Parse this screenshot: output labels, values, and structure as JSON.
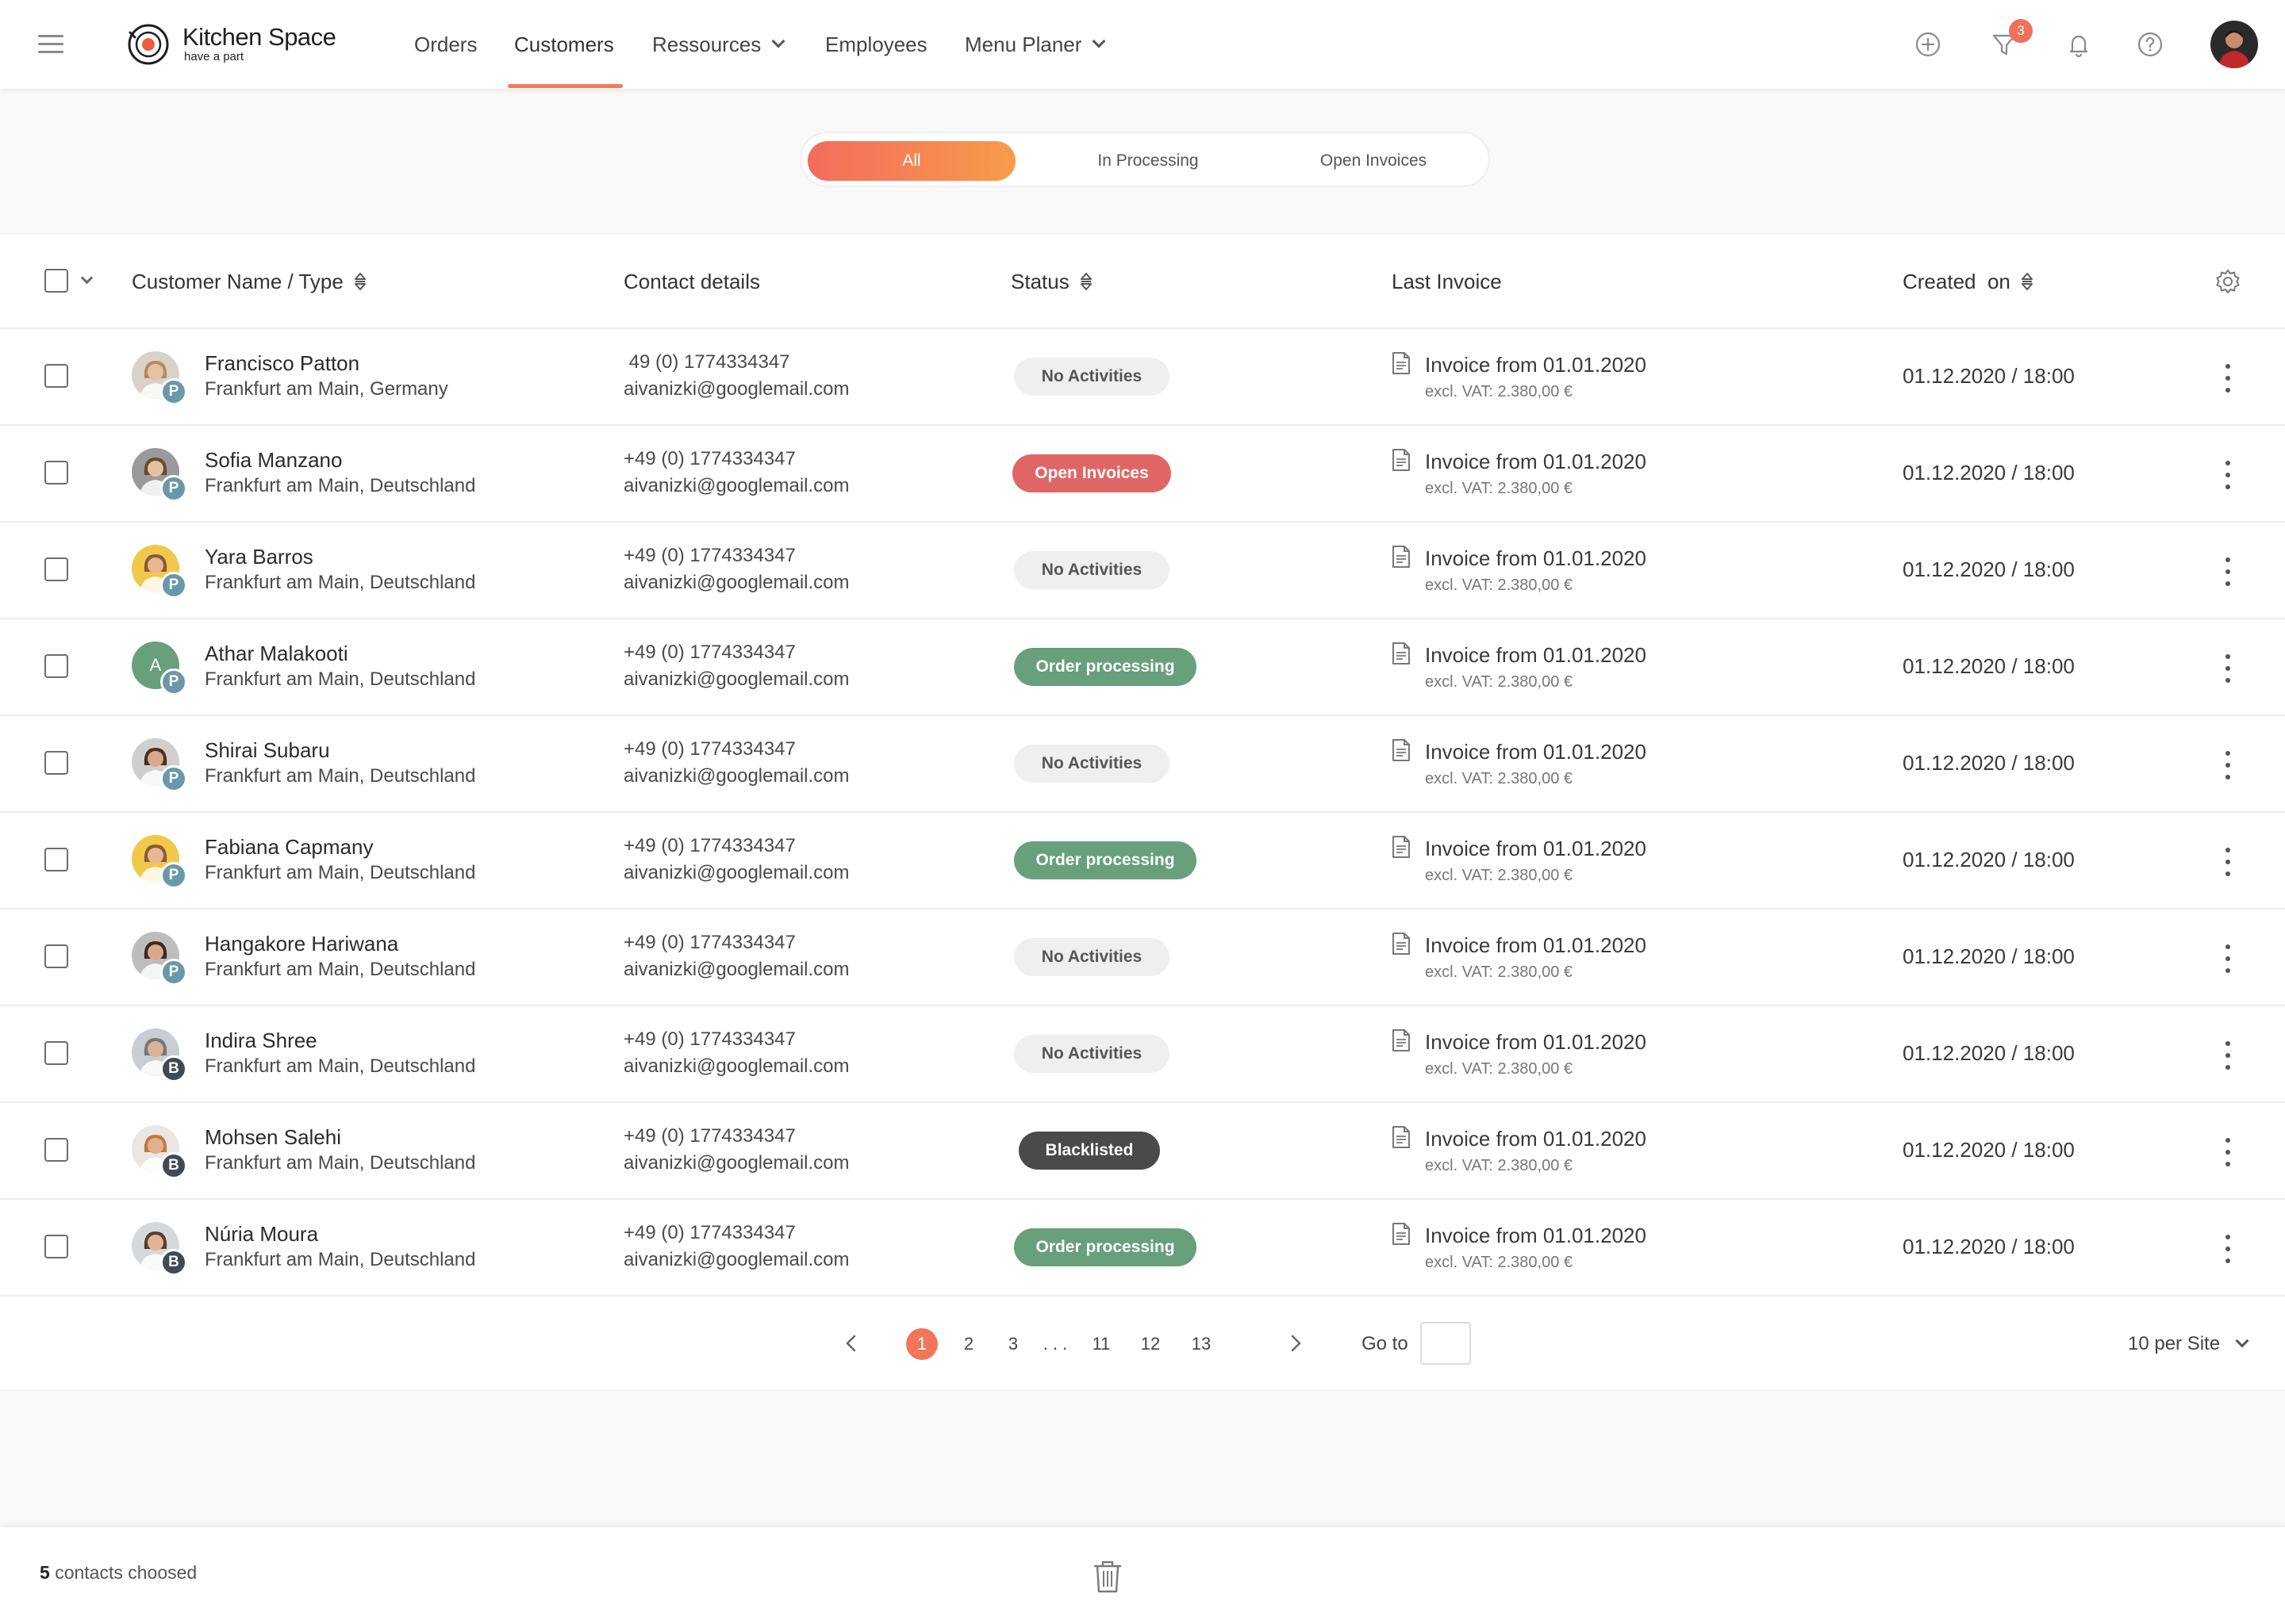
{
  "brand": {
    "name": "Kitchen Space",
    "tagline": "have a part",
    "accent_color": "#f47a55"
  },
  "nav": {
    "items": [
      {
        "label": "Orders",
        "active": false
      },
      {
        "label": "Customers",
        "active": true
      },
      {
        "label": "Ressources",
        "active": false,
        "dropdown": true
      },
      {
        "label": "Employees",
        "active": false
      },
      {
        "label": "Menu Planer",
        "active": false,
        "dropdown": true
      }
    ]
  },
  "header": {
    "filter_badge_count": "3",
    "icons": [
      "plus-circle-icon",
      "filter-icon",
      "bell-icon",
      "help-icon"
    ]
  },
  "filters": {
    "tabs": [
      "All",
      "In Processing",
      "Open Invoices"
    ],
    "active": "All"
  },
  "table": {
    "columns": {
      "name": "Customer Name / Type",
      "contact": "Contact details",
      "status": "Status",
      "invoice": "Last Invoice",
      "created": "Created  on"
    },
    "rows": [
      {
        "name": "Francisco Patton",
        "city": "Frankfurt am Main, Germany",
        "phone": " 49 (0) 1774334347",
        "email": "aivanizki@googlemail.com",
        "status": "No Activities",
        "status_type": "none",
        "type": "P",
        "invoice": "Invoice from 01.01.2020",
        "vat": "excl. VAT: 2.380,00 €",
        "created": "01.12.2020 / 18:00"
      },
      {
        "name": "Sofia Manzano",
        "city": "Frankfurt am Main, Deutschland",
        "phone": "+49 (0) 1774334347",
        "email": "aivanizki@googlemail.com",
        "status": "Open Invoices",
        "status_type": "open",
        "type": "P",
        "invoice": "Invoice from 01.01.2020",
        "vat": "excl. VAT: 2.380,00 €",
        "created": "01.12.2020 / 18:00"
      },
      {
        "name": "Yara Barros",
        "city": "Frankfurt am Main, Deutschland",
        "phone": "+49 (0) 1774334347",
        "email": "aivanizki@googlemail.com",
        "status": "No Activities",
        "status_type": "none",
        "type": "P",
        "invoice": "Invoice from 01.01.2020",
        "vat": "excl. VAT: 2.380,00 €",
        "created": "01.12.2020 / 18:00"
      },
      {
        "name": "Athar Malakooti",
        "city": "Frankfurt am Main, Deutschland",
        "phone": "+49 (0) 1774334347",
        "email": "aivanizki@googlemail.com",
        "status": "Order processing",
        "status_type": "proc",
        "type": "P",
        "initial": "A",
        "invoice": "Invoice from 01.01.2020",
        "vat": "excl. VAT: 2.380,00 €",
        "created": "01.12.2020 / 18:00"
      },
      {
        "name": "Shirai Subaru",
        "city": "Frankfurt am Main, Deutschland",
        "phone": "+49 (0) 1774334347",
        "email": "aivanizki@googlemail.com",
        "status": "No Activities",
        "status_type": "none",
        "type": "P",
        "invoice": "Invoice from 01.01.2020",
        "vat": "excl. VAT: 2.380,00 €",
        "created": "01.12.2020 / 18:00"
      },
      {
        "name": "Fabiana Capmany",
        "city": "Frankfurt am Main, Deutschland",
        "phone": "+49 (0) 1774334347",
        "email": "aivanizki@googlemail.com",
        "status": "Order processing",
        "status_type": "proc",
        "type": "P",
        "invoice": "Invoice from 01.01.2020",
        "vat": "excl. VAT: 2.380,00 €",
        "created": "01.12.2020 / 18:00"
      },
      {
        "name": "Hangakore Hariwana",
        "city": "Frankfurt am Main, Deutschland",
        "phone": "+49 (0) 1774334347",
        "email": "aivanizki@googlemail.com",
        "status": "No Activities",
        "status_type": "none",
        "type": "P",
        "invoice": "Invoice from 01.01.2020",
        "vat": "excl. VAT: 2.380,00 €",
        "created": "01.12.2020 / 18:00"
      },
      {
        "name": "Indira Shree",
        "city": "Frankfurt am Main, Deutschland",
        "phone": "+49 (0) 1774334347",
        "email": "aivanizki@googlemail.com",
        "status": "No Activities",
        "status_type": "none",
        "type": "B",
        "invoice": "Invoice from 01.01.2020",
        "vat": "excl. VAT: 2.380,00 €",
        "created": "01.12.2020 / 18:00"
      },
      {
        "name": "Mohsen Salehi",
        "city": "Frankfurt am Main, Deutschland",
        "phone": "+49 (0) 1774334347",
        "email": "aivanizki@googlemail.com",
        "status": "Blacklisted",
        "status_type": "black",
        "type": "B",
        "invoice": "Invoice from 01.01.2020",
        "vat": "excl. VAT: 2.380,00 €",
        "created": "01.12.2020 / 18:00"
      },
      {
        "name": "Núria Moura",
        "city": "Frankfurt am Main, Deutschland",
        "phone": "+49 (0) 1774334347",
        "email": "aivanizki@googlemail.com",
        "status": "Order processing",
        "status_type": "proc",
        "type": "B",
        "invoice": "Invoice from 01.01.2020",
        "vat": "excl. VAT: 2.380,00 €",
        "created": "01.12.2020 / 18:00"
      }
    ]
  },
  "pagination": {
    "pages": [
      "1",
      "2",
      "3",
      ". . .",
      "11",
      "12",
      "13"
    ],
    "current": "1",
    "goto_label": "Go to",
    "goto_value": "",
    "per_site": "10 per Site"
  },
  "footer": {
    "count": "5",
    "text": "contacts choosed"
  },
  "colors": {
    "status_none": "#efefef",
    "status_open": "#e06666",
    "status_processing": "#67a07a",
    "status_blacklisted": "#4a4a4a",
    "type_p": "#6a98a8",
    "type_b": "#3f4a52"
  }
}
